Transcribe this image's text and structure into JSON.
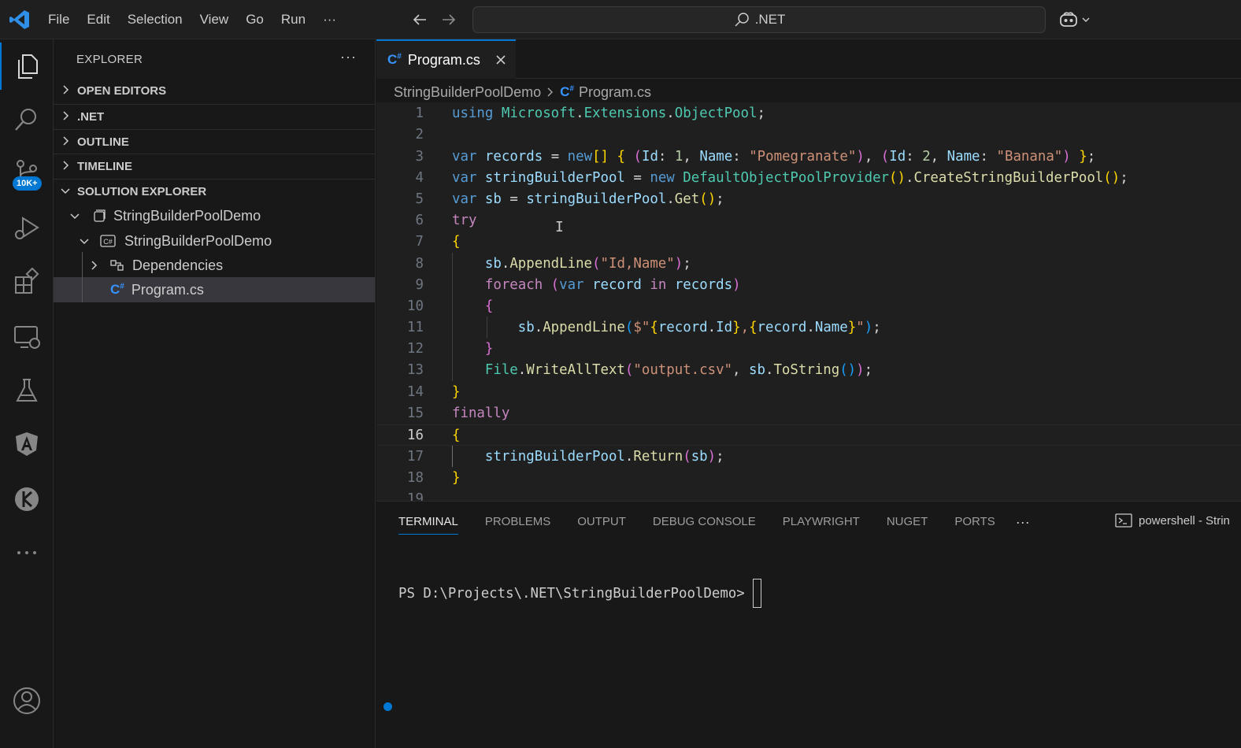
{
  "menu": [
    "File",
    "Edit",
    "Selection",
    "View",
    "Go",
    "Run",
    "···"
  ],
  "search": {
    "text": ".NET"
  },
  "activity": {
    "badge": "10K+"
  },
  "sidebar": {
    "title": "EXPLORER",
    "more": "···",
    "sections": [
      "OPEN EDITORS",
      ".NET",
      "OUTLINE",
      "TIMELINE",
      "SOLUTION EXPLORER"
    ],
    "tree": [
      "StringBuilderPoolDemo",
      "StringBuilderPoolDemo",
      "Dependencies",
      "Program.cs"
    ]
  },
  "editor": {
    "tab_label": "Program.cs",
    "breadcrumb": [
      "StringBuilderPoolDemo",
      "Program.cs"
    ],
    "line_numbers": [
      "1",
      "2",
      "3",
      "4",
      "5",
      "6",
      "7",
      "8",
      "9",
      "10",
      "11",
      "12",
      "13",
      "14",
      "15",
      "16",
      "17",
      "18",
      "19"
    ],
    "current_line": "16"
  },
  "panel": {
    "tabs": [
      "TERMINAL",
      "PROBLEMS",
      "OUTPUT",
      "DEBUG CONSOLE",
      "PLAYWRIGHT",
      "NUGET",
      "PORTS"
    ],
    "more": "···",
    "shell_label": "powershell - Strin",
    "prompt": "PS D:\\Projects\\.NET\\StringBuilderPoolDemo>"
  },
  "colors": {
    "accent": "#0078d4",
    "editor_bg": "#1f1f1f",
    "sidebar_bg": "#181818",
    "csharp_icon": "#3794ff"
  }
}
